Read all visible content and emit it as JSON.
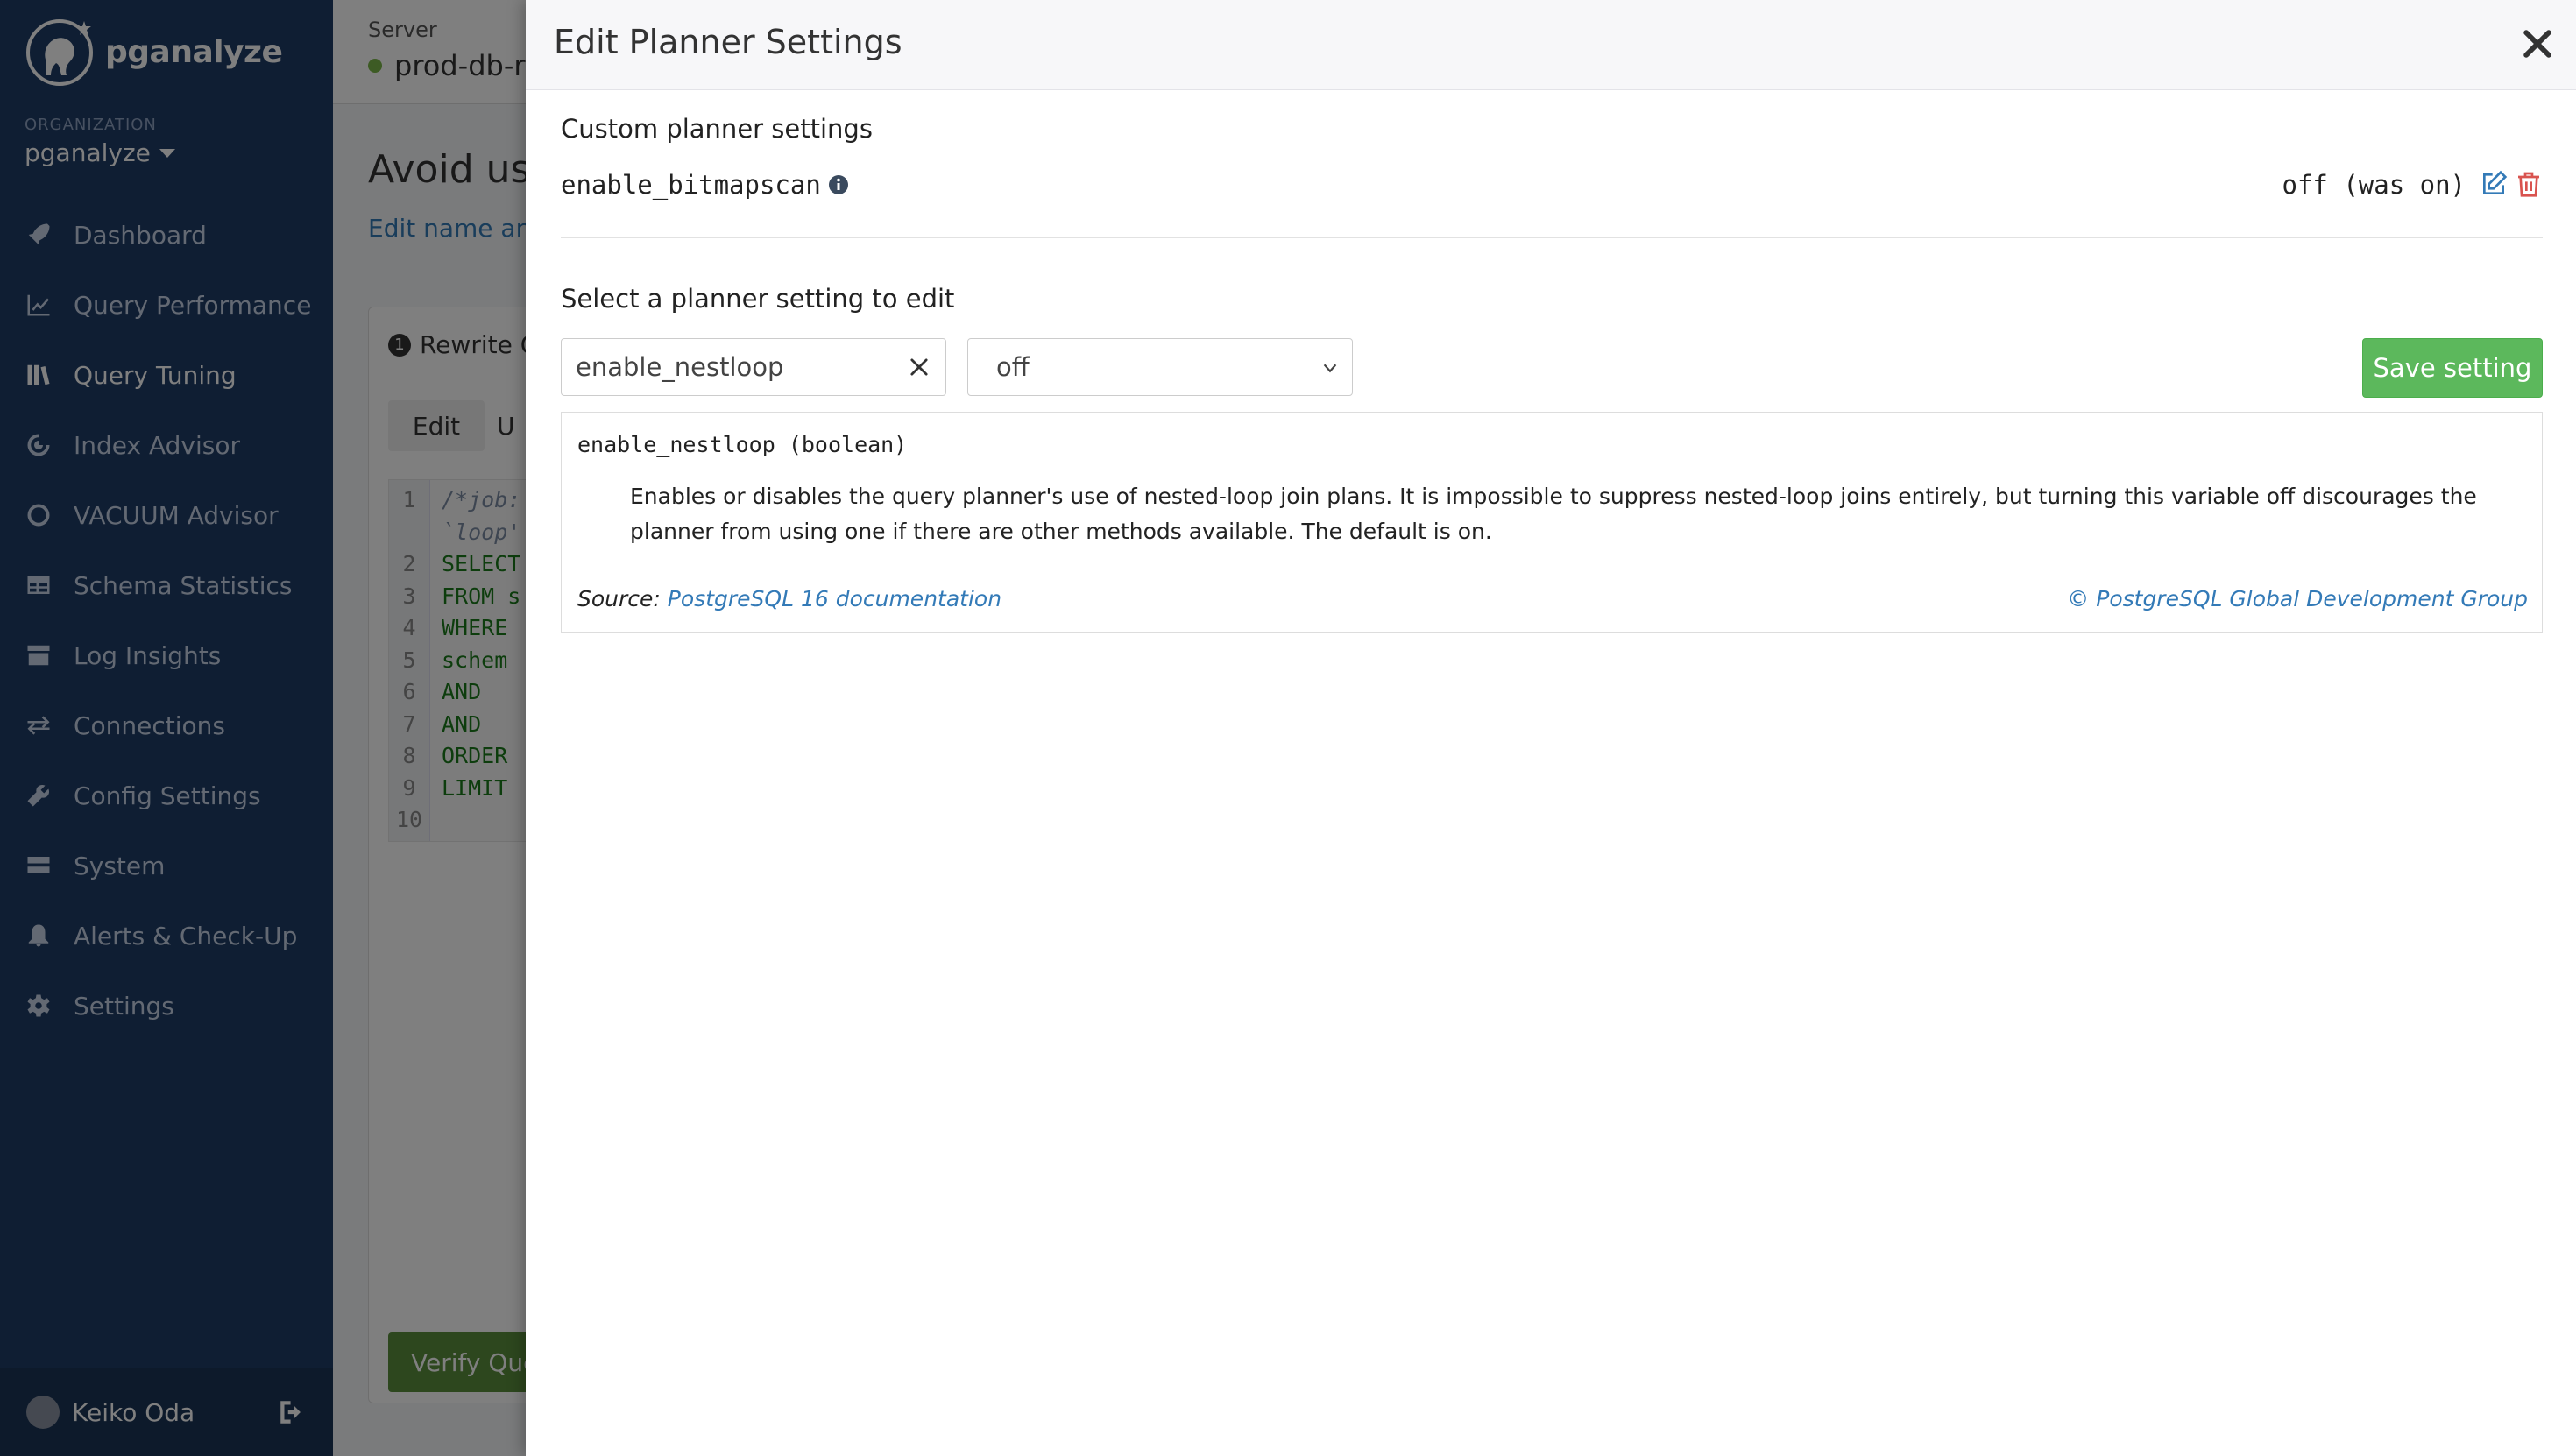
{
  "sidebar": {
    "logo_text": "pganalyze",
    "org_label": "ORGANIZATION",
    "org_name": "pganalyze",
    "items": [
      {
        "label": "Dashboard",
        "icon": "rocket-icon",
        "active": false
      },
      {
        "label": "Query Performance",
        "icon": "line-chart-icon",
        "active": false
      },
      {
        "label": "Query Tuning",
        "icon": "books-icon",
        "active": true
      },
      {
        "label": "Index Advisor",
        "icon": "target-icon",
        "active": false
      },
      {
        "label": "VACUUM Advisor",
        "icon": "circle-icon",
        "active": false
      },
      {
        "label": "Schema Statistics",
        "icon": "table-icon",
        "active": false
      },
      {
        "label": "Log Insights",
        "icon": "archive-icon",
        "active": false
      },
      {
        "label": "Connections",
        "icon": "exchange-icon",
        "active": false
      },
      {
        "label": "Config Settings",
        "icon": "wrench-icon",
        "active": false
      },
      {
        "label": "System",
        "icon": "server-icon",
        "active": false
      },
      {
        "label": "Alerts & Check-Up",
        "icon": "bell-icon",
        "active": false
      },
      {
        "label": "Settings",
        "icon": "gear-icon",
        "active": false
      }
    ],
    "user_name": "Keiko Oda"
  },
  "topbar": {
    "server_label": "Server",
    "server_name": "prod-db-r"
  },
  "main": {
    "title": "Avoid us",
    "link": "Edit name and",
    "card": {
      "badge": "1",
      "title": "Rewrite Q",
      "tab_edit": "Edit",
      "tab_second": "U",
      "code_lines": [
        {
          "n": "1",
          "text": "/*job:",
          "comment": true
        },
        {
          "n": "",
          "text": "`loop'",
          "comment": true
        },
        {
          "n": "2",
          "text": "SELECT",
          "comment": false
        },
        {
          "n": "3",
          "text": "FROM s",
          "comment": false
        },
        {
          "n": "4",
          "text": "WHERE",
          "comment": false
        },
        {
          "n": "5",
          "text": "  schem",
          "comment": false
        },
        {
          "n": "6",
          "text": "  AND",
          "comment": false
        },
        {
          "n": "7",
          "text": "  AND",
          "comment": false
        },
        {
          "n": "8",
          "text": "ORDER",
          "comment": false
        },
        {
          "n": "9",
          "text": "LIMIT",
          "comment": false
        },
        {
          "n": "10",
          "text": "",
          "comment": false
        }
      ],
      "verify_label": "Verify Que"
    }
  },
  "modal": {
    "title": "Edit Planner Settings",
    "custom_section_title": "Custom planner settings",
    "custom_setting": {
      "name": "enable_bitmapscan",
      "value": "off (was on)"
    },
    "select_section_title": "Select a planner setting to edit",
    "search_value": "enable_nestloop",
    "select_value": "off",
    "save_label": "Save setting",
    "doc": {
      "heading": "enable_nestloop (boolean)",
      "body": "Enables or disables the query planner's use of nested-loop join plans. It is impossible to suppress nested-loop joins entirely, but turning this variable off discourages the planner from using one if there are other methods available. The default is on.",
      "source_label": "Source:",
      "source_link": "PostgreSQL 16 documentation",
      "copyright": "© PostgreSQL Global Development Group"
    }
  },
  "colors": {
    "sidebar_bg": "#1f3c66",
    "save_green": "#5cb85c",
    "link_blue": "#337ab7",
    "delete_red": "#d9534f"
  }
}
